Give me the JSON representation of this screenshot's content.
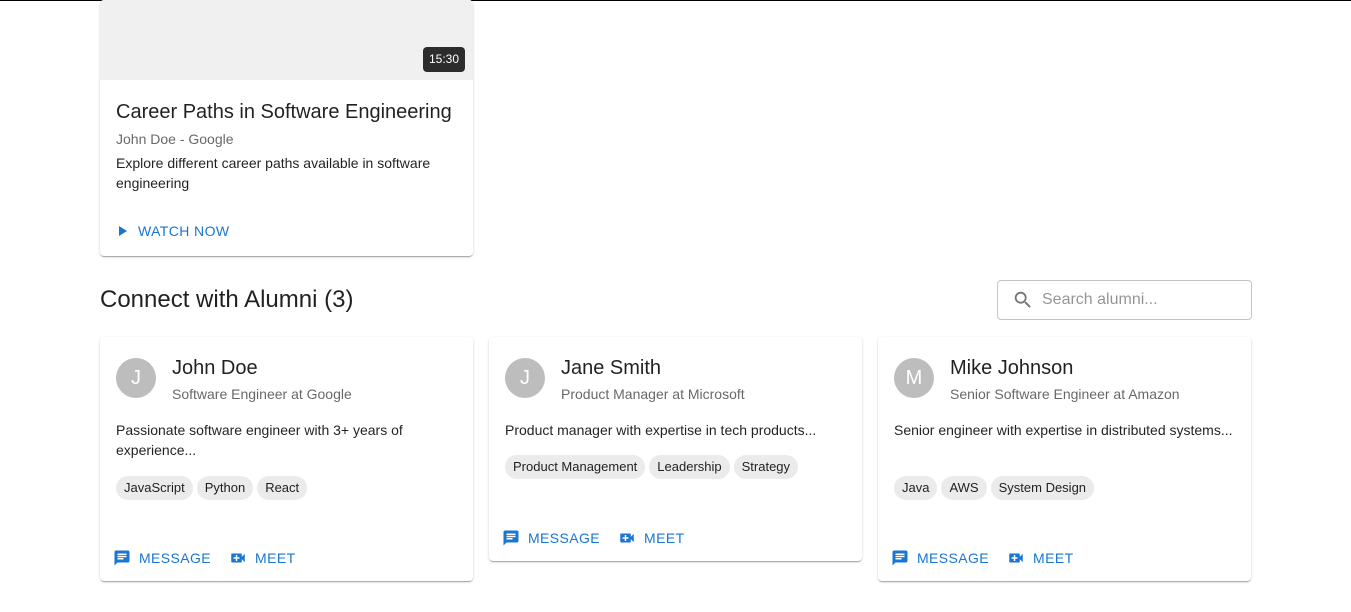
{
  "video": {
    "duration": "15:30",
    "title": "Career Paths in Software Engineering",
    "speaker": "John Doe - Google",
    "description": "Explore different career paths available in software engineering",
    "watch_label": "WATCH NOW"
  },
  "alumni_section": {
    "title": "Connect with Alumni (3)",
    "search_placeholder": "Search alumni...",
    "search_value": ""
  },
  "alumni": [
    {
      "initial": "J",
      "name": "John Doe",
      "role": "Software Engineer at Google",
      "bio": "Passionate software engineer with 3+ years of experience...",
      "skills": [
        "JavaScript",
        "Python",
        "React"
      ],
      "message_label": "MESSAGE",
      "meet_label": "MEET"
    },
    {
      "initial": "J",
      "name": "Jane Smith",
      "role": "Product Manager at Microsoft",
      "bio": "Product manager with expertise in tech products...",
      "skills": [
        "Product Management",
        "Leadership",
        "Strategy"
      ],
      "message_label": "MESSAGE",
      "meet_label": "MEET"
    },
    {
      "initial": "M",
      "name": "Mike Johnson",
      "role": "Senior Software Engineer at Amazon",
      "bio": "Senior engineer with expertise in distributed systems...",
      "skills": [
        "Java",
        "AWS",
        "System Design"
      ],
      "message_label": "MESSAGE",
      "meet_label": "MEET"
    }
  ],
  "colors": {
    "primary": "#1976d2",
    "avatar_bg": "#bdbdbd",
    "chip_bg": "#ebebeb",
    "thumbnail_bg": "#f0f0f0"
  }
}
